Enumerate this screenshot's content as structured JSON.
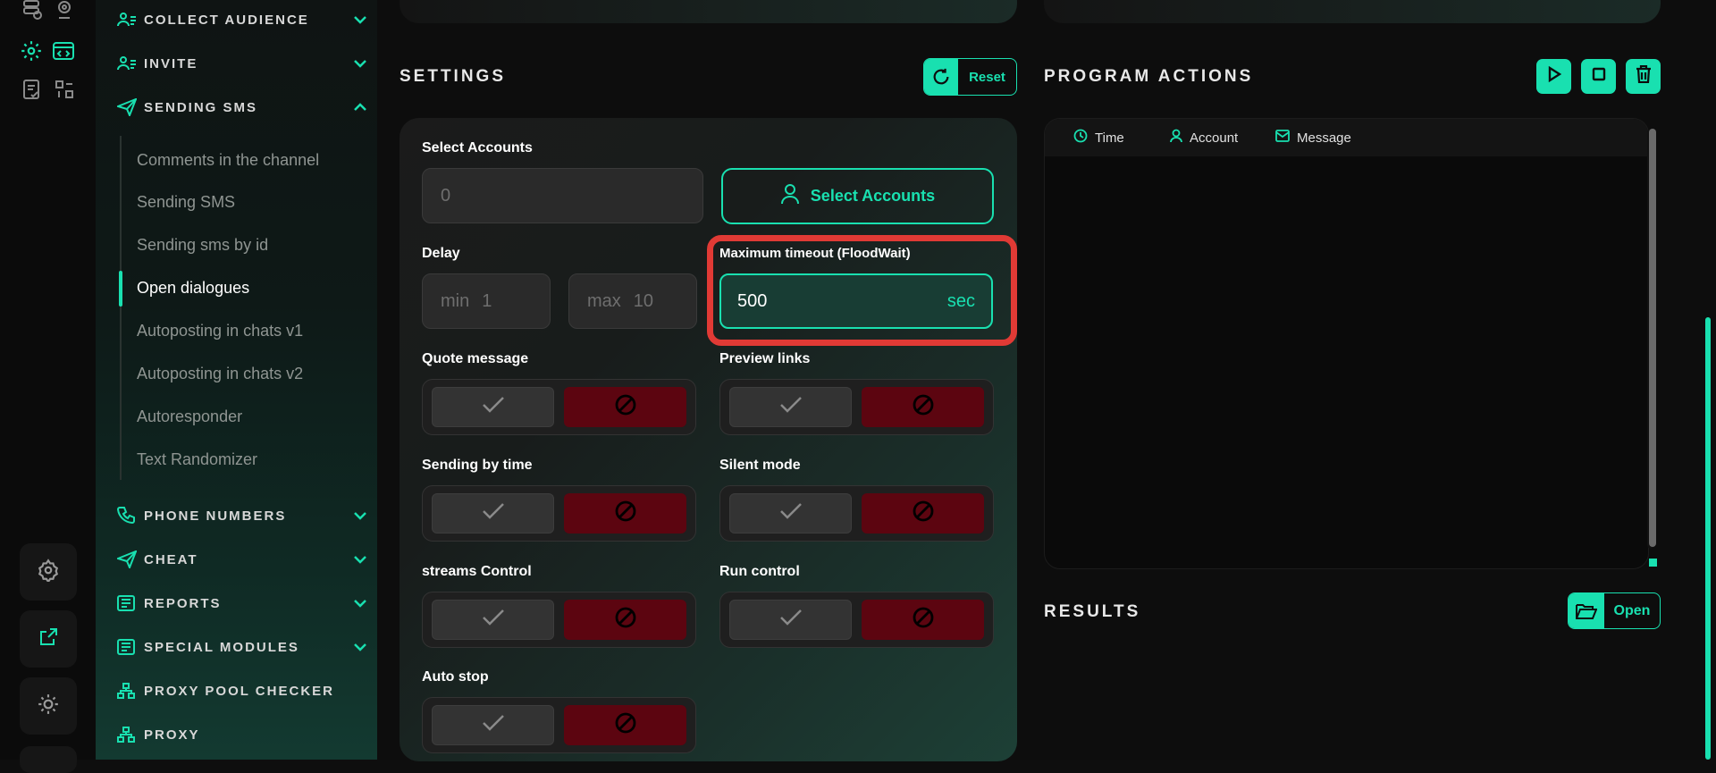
{
  "colors": {
    "accent": "#19e0b0",
    "danger": "#5c0510",
    "highlight": "#e03a35"
  },
  "rail": {
    "icons": [
      "database-icon",
      "webcam-icon",
      "gear-icon",
      "code-window-icon",
      "document-check-icon",
      "swap-icon"
    ],
    "buttons": [
      "settings-icon",
      "external-link-icon",
      "theme-icon"
    ]
  },
  "sidebar": {
    "sections": [
      {
        "label": "COLLECT AUDIENCE",
        "icon": "users-icon",
        "expanded": false
      },
      {
        "label": "INVITE",
        "icon": "users-icon",
        "expanded": false
      },
      {
        "label": "SENDING SMS",
        "icon": "send-icon",
        "expanded": true
      },
      {
        "label": "PHONE NUMBERS",
        "icon": "phone-icon",
        "expanded": false
      },
      {
        "label": "CHEAT",
        "icon": "send-icon",
        "expanded": false
      },
      {
        "label": "REPORTS",
        "icon": "newspaper-icon",
        "expanded": false
      },
      {
        "label": "SPECIAL MODULES",
        "icon": "newspaper-icon",
        "expanded": false
      },
      {
        "label": "PROXY POOL CHECKER",
        "icon": "network-icon"
      },
      {
        "label": "PROXY",
        "icon": "network-icon"
      }
    ],
    "sub_items": [
      "Comments in the channel",
      "Sending SMS",
      "Sending sms by id",
      "Open dialogues",
      "Autoposting in chats v1",
      "Autoposting in chats v2",
      "Autoresponder",
      "Text Randomizer"
    ],
    "active_sub_item": "Open dialogues"
  },
  "settings": {
    "title": "SETTINGS",
    "reset_label": "Reset",
    "select_accounts_label": "Select Accounts",
    "accounts_value": "0",
    "select_accounts_button": "Select Accounts",
    "delay_label": "Delay",
    "delay_min_placeholder": "min",
    "delay_min_value": "1",
    "delay_max_placeholder": "max",
    "delay_max_value": "10",
    "max_timeout_label": "Maximum timeout (FloodWait)",
    "max_timeout_value": "500",
    "max_timeout_unit": "sec",
    "toggles": [
      {
        "label": "Quote message"
      },
      {
        "label": "Preview links"
      },
      {
        "label": "Sending by time"
      },
      {
        "label": "Silent mode"
      },
      {
        "label": "streams Control"
      },
      {
        "label": "Run control"
      },
      {
        "label": "Auto stop"
      }
    ]
  },
  "program_actions": {
    "title": "PROGRAM ACTIONS",
    "buttons": [
      "play-icon",
      "stop-icon",
      "trash-icon"
    ],
    "columns": [
      {
        "label": "Time",
        "icon": "clock-icon"
      },
      {
        "label": "Account",
        "icon": "user-icon"
      },
      {
        "label": "Message",
        "icon": "mail-icon"
      }
    ]
  },
  "results": {
    "title": "RESULTS",
    "open_label": "Open"
  }
}
